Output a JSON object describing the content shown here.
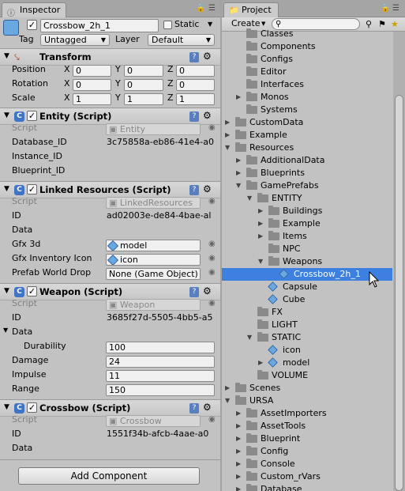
{
  "inspector": {
    "tab_label": "Inspector",
    "object_name": "Crossbow_2h_1",
    "static_label": "Static",
    "tag_label": "Tag",
    "tag_value": "Untagged",
    "layer_label": "Layer",
    "layer_value": "Default",
    "transform": {
      "title": "Transform",
      "position_label": "Position",
      "rotation_label": "Rotation",
      "scale_label": "Scale",
      "axis": [
        "X",
        "Y",
        "Z"
      ],
      "position": [
        "0",
        "0",
        "0"
      ],
      "rotation": [
        "0",
        "0",
        "0"
      ],
      "scale": [
        "1",
        "1",
        "1"
      ]
    },
    "entity": {
      "title": "Entity (Script)",
      "script_label": "Script",
      "script_value": "Entity",
      "database_label": "Database_ID",
      "database_value": "3c75858a-eb86-41e4-a0",
      "instance_label": "Instance_ID",
      "blueprint_label": "Blueprint_ID"
    },
    "linked": {
      "title": "Linked Resources (Script)",
      "script_label": "Script",
      "script_value": "LinkedResources",
      "id_label": "ID",
      "id_value": "ad02003e-de84-4bae-al",
      "data_label": "Data",
      "gfx3d_label": "Gfx 3d",
      "gfx3d_value": "model",
      "gfxinv_label": "Gfx Inventory Icon",
      "gfxinv_value": "icon",
      "prefab_label": "Prefab World Drop",
      "prefab_value": "None (Game Object)"
    },
    "weapon": {
      "title": "Weapon (Script)",
      "script_label": "Script",
      "script_value": "Weapon",
      "id_label": "ID",
      "id_value": "3685f27d-5505-4bb5-a5",
      "data_label": "Data",
      "durability_label": "Durability",
      "durability_value": "100",
      "damage_label": "Damage",
      "damage_value": "24",
      "impulse_label": "Impulse",
      "impulse_value": "11",
      "range_label": "Range",
      "range_value": "150"
    },
    "crossbow": {
      "title": "Crossbow (Script)",
      "script_label": "Script",
      "script_value": "Crossbow",
      "id_label": "ID",
      "id_value": "1551f34b-afcb-4aae-a0",
      "data_label": "Data"
    },
    "add_component": "Add Component"
  },
  "project": {
    "tab_label": "Project",
    "create_label": "Create",
    "items": [
      {
        "label": "Classes",
        "depth": 2,
        "kind": "folder",
        "expand": "none"
      },
      {
        "label": "Components",
        "depth": 2,
        "kind": "folder",
        "expand": "none"
      },
      {
        "label": "Configs",
        "depth": 2,
        "kind": "folder",
        "expand": "none"
      },
      {
        "label": "Editor",
        "depth": 2,
        "kind": "folder",
        "expand": "none"
      },
      {
        "label": "Interfaces",
        "depth": 2,
        "kind": "folder",
        "expand": "none"
      },
      {
        "label": "Monos",
        "depth": 2,
        "kind": "folder",
        "expand": "closed"
      },
      {
        "label": "Systems",
        "depth": 2,
        "kind": "folder",
        "expand": "none"
      },
      {
        "label": "CustomData",
        "depth": 1,
        "kind": "folder",
        "expand": "closed"
      },
      {
        "label": "Example",
        "depth": 1,
        "kind": "folder",
        "expand": "closed"
      },
      {
        "label": "Resources",
        "depth": 1,
        "kind": "folder",
        "expand": "open"
      },
      {
        "label": "AdditionalData",
        "depth": 2,
        "kind": "folder",
        "expand": "closed"
      },
      {
        "label": "Blueprints",
        "depth": 2,
        "kind": "folder",
        "expand": "closed"
      },
      {
        "label": "GamePrefabs",
        "depth": 2,
        "kind": "folder",
        "expand": "open"
      },
      {
        "label": "ENTITY",
        "depth": 3,
        "kind": "folder",
        "expand": "open"
      },
      {
        "label": "Buildings",
        "depth": 4,
        "kind": "folder",
        "expand": "closed"
      },
      {
        "label": "Example",
        "depth": 4,
        "kind": "folder",
        "expand": "closed"
      },
      {
        "label": "Items",
        "depth": 4,
        "kind": "folder",
        "expand": "closed"
      },
      {
        "label": "NPC",
        "depth": 4,
        "kind": "folder",
        "expand": "none"
      },
      {
        "label": "Weapons",
        "depth": 4,
        "kind": "folder",
        "expand": "open"
      },
      {
        "label": "Crossbow_2h_1",
        "depth": 5,
        "kind": "cube",
        "expand": "none",
        "selected": true
      },
      {
        "label": "Capsule",
        "depth": 4,
        "kind": "cube",
        "expand": "none"
      },
      {
        "label": "Cube",
        "depth": 4,
        "kind": "cube",
        "expand": "none"
      },
      {
        "label": "FX",
        "depth": 3,
        "kind": "folder",
        "expand": "none"
      },
      {
        "label": "LIGHT",
        "depth": 3,
        "kind": "folder",
        "expand": "none"
      },
      {
        "label": "STATIC",
        "depth": 3,
        "kind": "folder",
        "expand": "open"
      },
      {
        "label": "icon",
        "depth": 4,
        "kind": "cube",
        "expand": "none"
      },
      {
        "label": "model",
        "depth": 4,
        "kind": "cube",
        "expand": "closed"
      },
      {
        "label": "VOLUME",
        "depth": 3,
        "kind": "folder",
        "expand": "none"
      },
      {
        "label": "Scenes",
        "depth": 1,
        "kind": "folder",
        "expand": "closed"
      },
      {
        "label": "URSA",
        "depth": 1,
        "kind": "folder",
        "expand": "open"
      },
      {
        "label": "AssetImporters",
        "depth": 2,
        "kind": "folder",
        "expand": "closed"
      },
      {
        "label": "AssetTools",
        "depth": 2,
        "kind": "folder",
        "expand": "closed"
      },
      {
        "label": "Blueprint",
        "depth": 2,
        "kind": "folder",
        "expand": "closed"
      },
      {
        "label": "Config",
        "depth": 2,
        "kind": "folder",
        "expand": "closed"
      },
      {
        "label": "Console",
        "depth": 2,
        "kind": "folder",
        "expand": "closed"
      },
      {
        "label": "Custom_rVars",
        "depth": 2,
        "kind": "folder",
        "expand": "closed"
      },
      {
        "label": "Database",
        "depth": 2,
        "kind": "folder",
        "expand": "closed"
      }
    ]
  }
}
